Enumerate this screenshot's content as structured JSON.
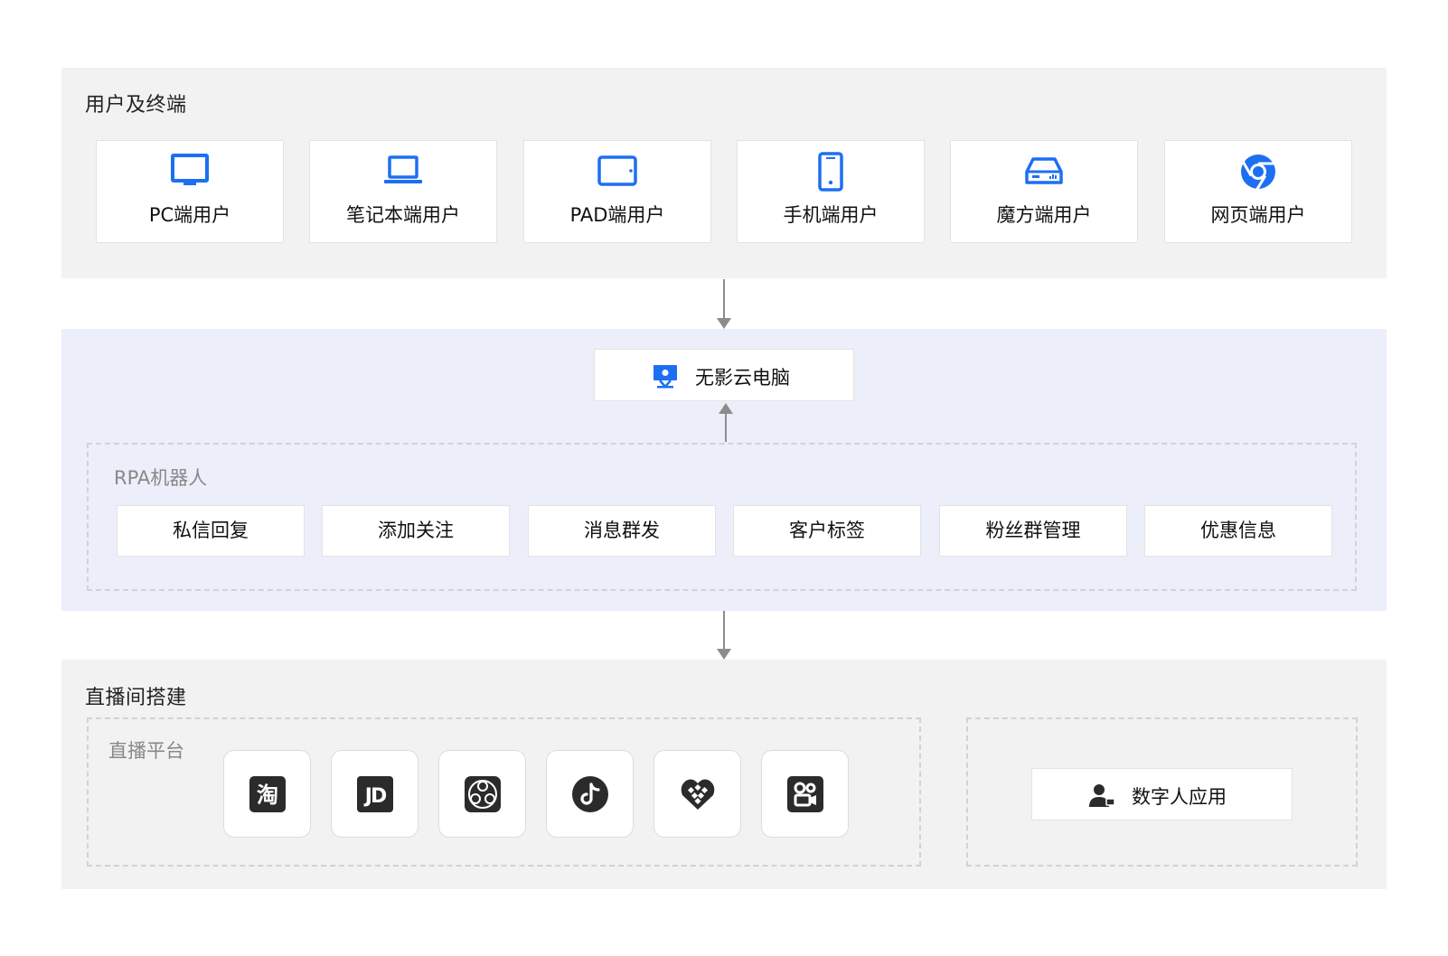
{
  "colors": {
    "accent_blue": "#1d6ff2",
    "user_section_bg": "#f2f2f2",
    "cloud_section_bg": "#eceefa",
    "arrow": "#8c8c8c",
    "app_icon_dark": "#2b2b2b"
  },
  "users": {
    "title": "用户及终端",
    "devices": [
      {
        "label": "PC端用户",
        "icon": "monitor-icon"
      },
      {
        "label": "笔记本端用户",
        "icon": "laptop-icon"
      },
      {
        "label": "PAD端用户",
        "icon": "tablet-icon"
      },
      {
        "label": "手机端用户",
        "icon": "phone-icon"
      },
      {
        "label": "魔方端用户",
        "icon": "cube-terminal-icon"
      },
      {
        "label": "网页端用户",
        "icon": "browser-icon"
      }
    ]
  },
  "cloud": {
    "cloud_pc_label": "无影云电脑",
    "rpa_title": "RPA机器人",
    "rpa_items": [
      "私信回复",
      "添加关注",
      "消息群发",
      "客户标签",
      "粉丝群管理",
      "优惠信息"
    ]
  },
  "live": {
    "title": "直播间搭建",
    "platform_title": "直播平台",
    "platforms": [
      {
        "icon": "taobao-icon",
        "glyph": "淘"
      },
      {
        "icon": "jd-icon",
        "glyph": "JD"
      },
      {
        "icon": "obs-icon"
      },
      {
        "icon": "douyin-icon"
      },
      {
        "icon": "pinduoduo-icon"
      },
      {
        "icon": "kuaishou-icon"
      }
    ],
    "digital_human_label": "数字人应用"
  }
}
